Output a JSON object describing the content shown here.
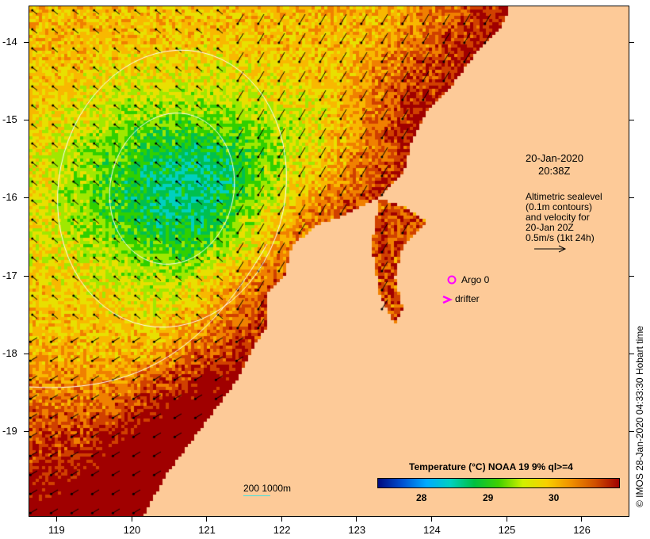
{
  "map": {
    "date": "20-Jan-2020",
    "time": "20:38Z",
    "legend_lines": [
      "Altimetric sealevel",
      "(0.1m contours)",
      "and velocity for",
      "20-Jan 20Z",
      "0.5m/s (1kt 24h)"
    ],
    "argo_label": "Argo 0",
    "drifter_label": "drifter",
    "depth_label": "200  1000m",
    "colorbar_title": "Temperature (°C) NOAA 19 9% ql>=4",
    "colorbar_ticks": [
      "28",
      "29",
      "30"
    ],
    "lon_ticks": [
      "119",
      "120",
      "121",
      "122",
      "123",
      "124",
      "125",
      "126"
    ],
    "lat_ticks": [
      "-14",
      "-15",
      "-16",
      "-17",
      "-18",
      "-19"
    ],
    "credit": "© IMOS 28-Jan-2020 04:33:30 Hobart time",
    "colors": {
      "land": "#fdca98",
      "argo": "#ff00ff",
      "depth_contour": "#40e0e0"
    }
  }
}
